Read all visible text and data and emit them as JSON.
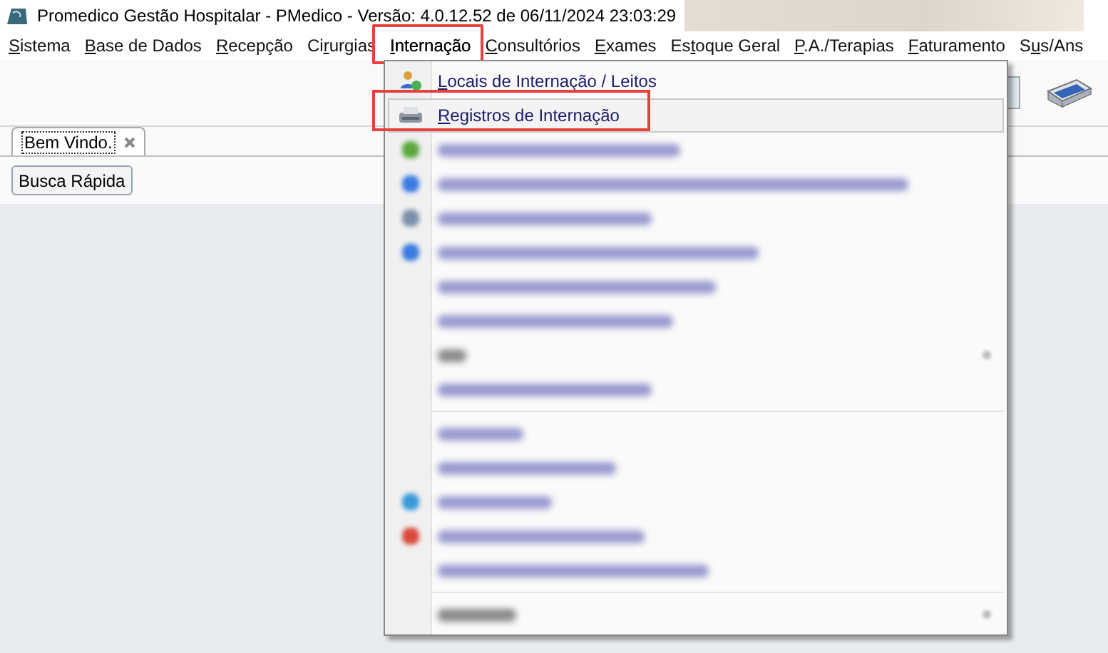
{
  "window": {
    "title": "Promedico Gestão Hospitalar - PMedico - Versão: 4.0.12.52 de 06/11/2024 23:03:29",
    "title_redacted": true
  },
  "menu_bar": [
    {
      "key": "S",
      "after": "istema",
      "open": false,
      "annotated": false
    },
    {
      "key": "B",
      "after": "ase de Dados",
      "open": false,
      "annotated": false
    },
    {
      "key": "R",
      "after": "ecepção",
      "open": false,
      "annotated": false
    },
    {
      "before": "Ci",
      "key": "r",
      "after": "urgias",
      "open": false,
      "annotated": false
    },
    {
      "key": "I",
      "after": "nternação",
      "open": true,
      "annotated": true
    },
    {
      "key": "C",
      "after": "onsultórios",
      "open": false,
      "annotated": false
    },
    {
      "key": "E",
      "after": "xames",
      "open": false,
      "annotated": false
    },
    {
      "before": "Es",
      "key": "t",
      "after": "oque Geral",
      "open": false,
      "annotated": false
    },
    {
      "key": "P",
      "after": ".A./Terapias",
      "open": false,
      "annotated": false
    },
    {
      "key": "F",
      "after": "aturamento",
      "open": false,
      "annotated": false
    },
    {
      "before": "S",
      "key": "u",
      "after": "s/Ans",
      "open": false,
      "annotated": false
    }
  ],
  "dropdown": [
    {
      "kind": "item",
      "key": "L",
      "after": "ocais de Internação / Leitos",
      "selected": false,
      "annotated": false
    },
    {
      "kind": "item",
      "key": "R",
      "after": "egistros de Internação",
      "selected": true,
      "annotated": true
    },
    {
      "kind": "blurred"
    },
    {
      "kind": "blurred"
    },
    {
      "kind": "blurred"
    },
    {
      "kind": "blurred"
    },
    {
      "kind": "blurred"
    },
    {
      "kind": "blurred"
    },
    {
      "kind": "blurred",
      "submenu": true
    },
    {
      "kind": "blurred"
    },
    {
      "kind": "separator"
    },
    {
      "kind": "blurred"
    },
    {
      "kind": "blurred"
    },
    {
      "kind": "blurred"
    },
    {
      "kind": "blurred"
    },
    {
      "kind": "blurred"
    },
    {
      "kind": "separator"
    },
    {
      "kind": "blurred",
      "submenu": true
    }
  ],
  "tabs": [
    {
      "label": "Bem Vindo.",
      "selected": true,
      "closable": true
    }
  ],
  "quick_search_button": "Busca Rápida"
}
